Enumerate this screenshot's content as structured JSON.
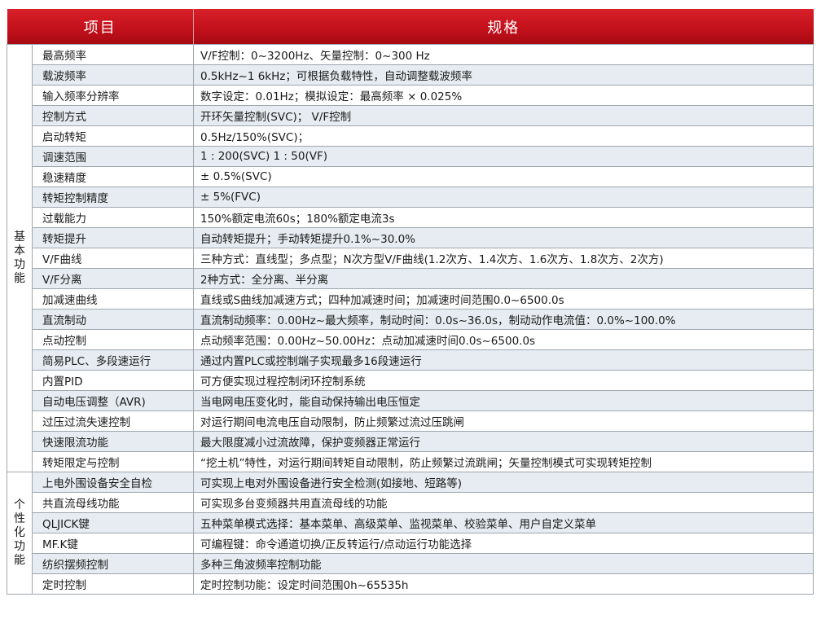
{
  "header": {
    "item_label": "项目",
    "spec_label": "规格"
  },
  "groups": [
    {
      "category": "基本功能",
      "rows": [
        [
          "最高频率",
          "V/F控制：0~3200Hz、矢量控制：0~300 Hz"
        ],
        [
          "载波频率",
          "0.5kHz~1 6kHz；可根据负载特性，自动调整载波频率"
        ],
        [
          "输入频率分辨率",
          "数字设定：0.01Hz；模拟设定：最高频率 × 0.025%"
        ],
        [
          "控制方式",
          "开环矢量控制(SVC)；  V/F控制"
        ],
        [
          "启动转矩",
          "0.5Hz/150%(SVC)；"
        ],
        [
          "调速范围",
          "1 : 200(SVC)              1 : 50(VF)"
        ],
        [
          "稳速精度",
          "± 0.5%(SVC)"
        ],
        [
          "转矩控制精度",
          "± 5%(FVC)"
        ],
        [
          "过载能力",
          "150%额定电流60s；180%额定电流3s"
        ],
        [
          "转矩提升",
          "自动转矩提升；手动转矩提升0.1%~30.0%"
        ],
        [
          "V/F曲线",
          "三种方式：直线型；多点型；N次方型V/F曲线(1.2次方、1.4次方、1.6次方、1.8次方、2次方)"
        ],
        [
          "V/F分离",
          "2种方式：全分离、半分离"
        ],
        [
          "加减速曲线",
          "直线或S曲线加减速方式；四种加减速时间；加减速时间范围0.0~6500.0s"
        ],
        [
          "直流制动",
          "直流制动频率：0.00Hz~最大频率，制动时间：0.0s~36.0s，制动动作电流值：0.0%~100.0%"
        ],
        [
          "点动控制",
          "点动频率范围：0.00Hz~50.00Hz：点动加减速时间0.0s~6500.0s"
        ],
        [
          "简易PLC、多段速运行",
          "通过内置PLC或控制端子实现最多16段速运行"
        ],
        [
          "内置PID",
          "可方便实现过程控制闭环控制系统"
        ],
        [
          "自动电压调整（AVR)",
          "当电网电压变化时，能自动保持输出电压恒定"
        ],
        [
          "过压过流失速控制",
          "对运行期间电流电压自动限制，防止频繁过流过压跳闸"
        ],
        [
          "快速限流功能",
          "最大限度减小过流故障，保护变频器正常运行"
        ],
        [
          "转矩限定与控制",
          "“挖土机”特性，对运行期间转矩自动限制，防止频繁过流跳闸；矢量控制模式可实现转矩控制"
        ]
      ]
    },
    {
      "category": "个性化功能",
      "rows": [
        [
          "上电外围设备安全自检",
          "可实现上电对外围设备进行安全检测(如接地、短路等)"
        ],
        [
          "共直流母线功能",
          "可实现多台变频器共用直流母线的功能"
        ],
        [
          "QLJICK键",
          "五种菜单模式选择：基本菜单、高级菜单、监视菜单、校验菜单、用户自定义菜单"
        ],
        [
          "MF.K键",
          "可编程键：命令通道切换/正反转运行/点动运行功能选择"
        ],
        [
          "纺织摆频控制",
          "多种三角波频率控制功能"
        ],
        [
          "定时控制",
          "定时控制功能：设定时间范围0h~65535h"
        ]
      ]
    }
  ],
  "colors": {
    "header_red": "#c3111b",
    "row_alt": "#e6ecf1",
    "border": "#9ea6ae"
  }
}
